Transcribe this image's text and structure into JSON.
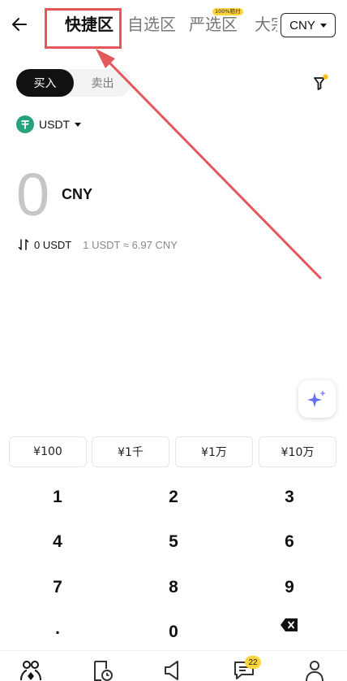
{
  "header": {
    "tabs": [
      {
        "label": "快捷区",
        "active": true
      },
      {
        "label": "自选区",
        "active": false
      },
      {
        "label": "严选区",
        "active": false
      },
      {
        "label": "大宗",
        "active": false
      }
    ],
    "select_badge": "100%赔付",
    "currency": "CNY",
    "icons": {
      "back": "arrow-left-icon",
      "caret": "caret-down-icon"
    }
  },
  "trade": {
    "buy_label": "买入",
    "sell_label": "卖出",
    "coin": "USDT",
    "amount": "0",
    "amount_unit": "CNY",
    "receive_text": "0 USDT",
    "rate_text": "1 USDT ≈ 6.97 CNY"
  },
  "quick_amounts": [
    "¥100",
    "¥1千",
    "¥1万",
    "¥10万"
  ],
  "keypad": [
    "1",
    "2",
    "3",
    "4",
    "5",
    "6",
    "7",
    "8",
    "9",
    ".",
    "0",
    "backspace"
  ],
  "bottom_nav": {
    "items": [
      "p2p-icon",
      "orders-icon",
      "announcement-icon",
      "chat-icon",
      "profile-icon"
    ],
    "chat_badge": "22"
  },
  "colors": {
    "accent_yellow": "#ffd53d",
    "annotation_red": "#e4575a",
    "usdt_green": "#26a17b",
    "primary": "#111111"
  }
}
